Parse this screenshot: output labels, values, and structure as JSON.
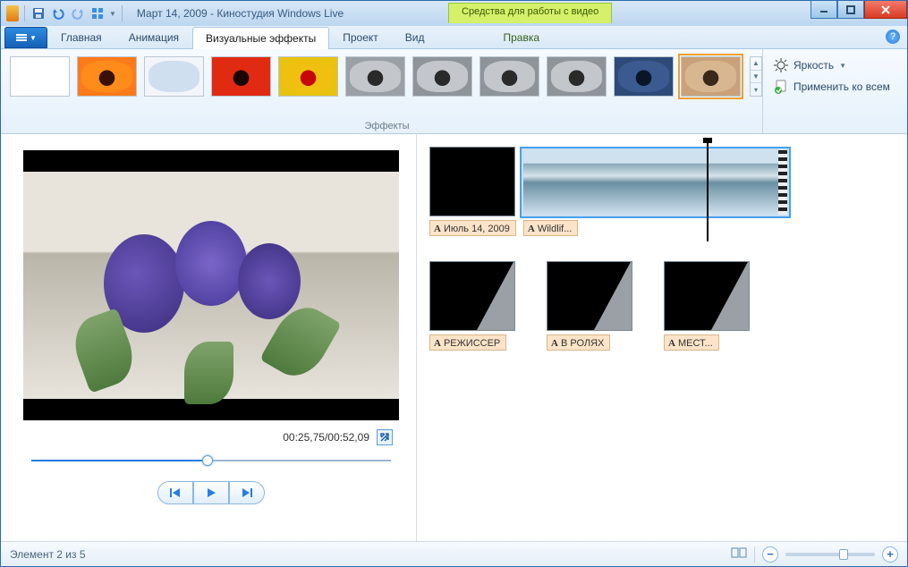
{
  "title": "Март 14, 2009 - Киностудия Windows Live",
  "contextual_label": "Средства для работы с видео",
  "tabs": {
    "home": "Главная",
    "animation": "Анимация",
    "visual_effects": "Визуальные эффекты",
    "project": "Проект",
    "view": "Вид",
    "editing": "Правка"
  },
  "ribbon": {
    "group_label": "Эффекты",
    "brightness": "Яркость",
    "apply_all": "Применить ко всем"
  },
  "effects": [
    {
      "id": "none",
      "bg": "#ffffff"
    },
    {
      "id": "warm",
      "bg": "#ff7a1a"
    },
    {
      "id": "sketch",
      "bg": "#f2f6fa"
    },
    {
      "id": "red-yellow",
      "bg": "#e02a12"
    },
    {
      "id": "red-yellow-2",
      "bg": "#e8c20e"
    },
    {
      "id": "mono-1",
      "bg": "#9aa0a6"
    },
    {
      "id": "mono-2",
      "bg": "#8e949a"
    },
    {
      "id": "mono-3",
      "bg": "#8e949a"
    },
    {
      "id": "mono-4",
      "bg": "#8e949a"
    },
    {
      "id": "blue-tone",
      "bg": "#2e4a78"
    },
    {
      "id": "sepia",
      "bg": "#c9a27a",
      "selected": true
    }
  ],
  "player": {
    "time": "00:25,75/00:52,09",
    "progress_pct": 49
  },
  "clips": {
    "title_date": "Июль 14, 2009",
    "wildlife": "Wildlif...",
    "credits": [
      "РЕЖИССЕР",
      "В РОЛЯХ",
      "МЕСТ..."
    ]
  },
  "status": {
    "element_of": "Элемент 2 из 5",
    "zoom_pct": 60
  }
}
